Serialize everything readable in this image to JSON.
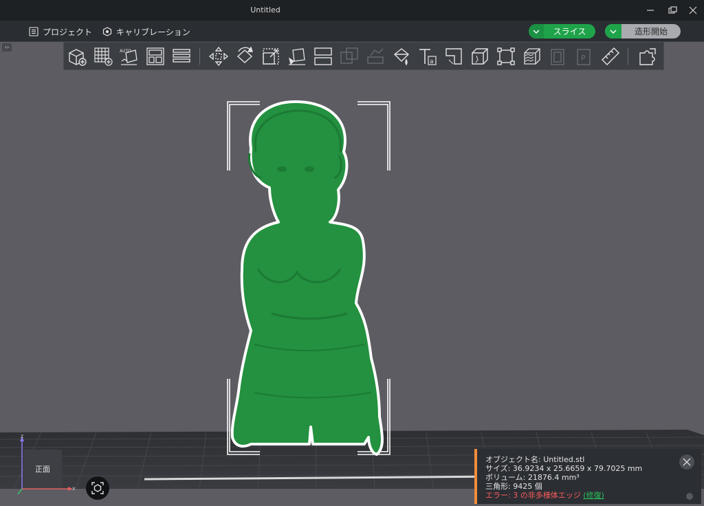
{
  "window": {
    "title": "Untitled"
  },
  "menu": {
    "project_label": "プロジェクト",
    "calibration_label": "キャリブレーション"
  },
  "actions": {
    "slice_label": "スライス",
    "print_label": "造形開始"
  },
  "toolbar": {
    "icons": [
      "add-object-icon",
      "arrange-grid-icon",
      "auto-orient-icon",
      "layout-icon",
      "layers-icon",
      "move-icon",
      "rotate-icon",
      "scale-icon",
      "place-on-face-icon",
      "split-icon",
      "boolean-icon",
      "cut-icon",
      "paint-bucket-icon",
      "text-icon",
      "corner-icon",
      "cube-icon",
      "bounding-box-icon",
      "texture-icon",
      "assembly-icon",
      "part-icon",
      "measure-icon",
      "puzzle-icon"
    ]
  },
  "viewport": {
    "view_label": "正面",
    "axis_x": "x",
    "axis_z": "z",
    "model_color": "#23913f"
  },
  "info": {
    "object_name": "オブジェクト名: Untitled.stl",
    "size": "サイズ: 36.9234 x 25.6659 x 79.7025 mm",
    "volume": "ボリューム: 21876.4 mm³",
    "triangles": "三角形: 9425 個",
    "error": "エラー: 3 の非多様体エッジ",
    "fix_label": "(修復)"
  },
  "colors": {
    "accent": "#1fa34a",
    "warning": "#f28d3c",
    "error": "#ff5c5c"
  }
}
